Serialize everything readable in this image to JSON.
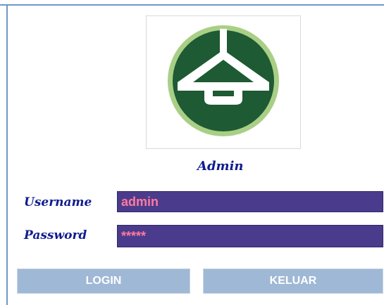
{
  "logo": {
    "icon": "lamp-emblem-icon",
    "colors": {
      "disc": "#1e5a33",
      "ring": "#a9cf86",
      "lamp": "#ffffff"
    }
  },
  "title": "Admin",
  "form": {
    "username_label": "Username",
    "username_value": "admin",
    "password_label": "Password",
    "password_value": "*****"
  },
  "buttons": {
    "login_label": "LOGIN",
    "exit_label": "KELUAR"
  },
  "colors": {
    "accent": "#0f1c8e",
    "input_bg": "#4b3b8c",
    "input_text": "#ff7a9e",
    "button_bg": "#9fb8d5"
  }
}
